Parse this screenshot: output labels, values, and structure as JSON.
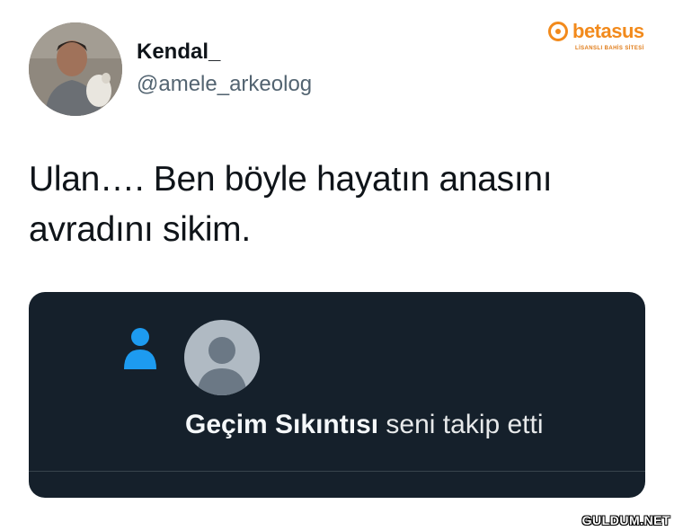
{
  "tweet": {
    "author": {
      "display_name": "Kendal_",
      "handle": "@amele_arkeolog"
    },
    "text": "Ulan…. Ben böyle hayatın anasını\navradını sikim."
  },
  "brand": {
    "name": "betasus",
    "tagline": "LİSANSLI BAHİS SİTESİ",
    "color": "#f28a1c"
  },
  "media": {
    "background": "#15202b",
    "icon": "follow-person-icon",
    "icon_color": "#1d9bf0",
    "follower_name": "Geçim Sıkıntısı",
    "action_text": " seni takip etti"
  },
  "watermark": "GULDUM.NET"
}
